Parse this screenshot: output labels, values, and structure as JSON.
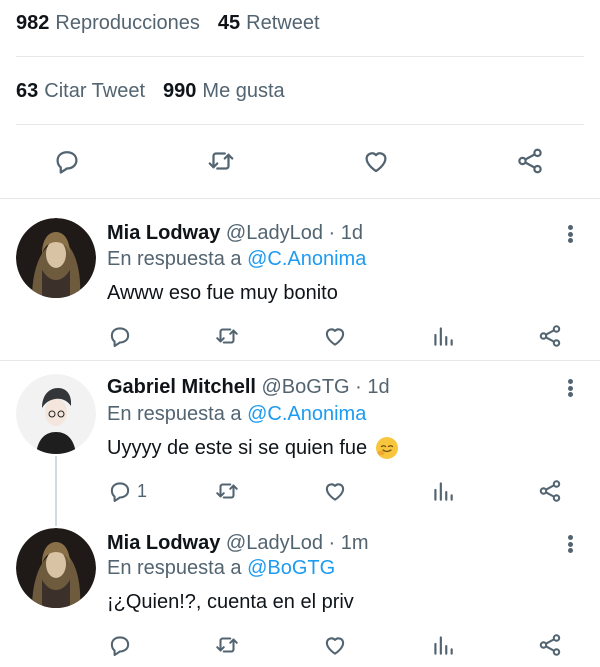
{
  "stats": {
    "views_count": "982",
    "views_label": "Reproducciones",
    "retweets_count": "45",
    "retweets_label": "Retweet",
    "quotes_count": "63",
    "quotes_label": "Citar Tweet",
    "likes_count": "990",
    "likes_label": "Me gusta"
  },
  "colors": {
    "accent": "#1d9bf0",
    "text": "#0f1419",
    "muted": "#536471",
    "divider": "#e4e8eb"
  },
  "main_actions": [
    "reply-icon",
    "retweet-icon",
    "like-icon",
    "share-icon"
  ],
  "replies": [
    {
      "name": "Mia Lodway",
      "handle": "@LadyLod",
      "time": "· 1d",
      "reply_prefix": "En respuesta a",
      "reply_to": "@C.Anonima",
      "text": "Awww eso fue muy bonito",
      "reply_count": ""
    },
    {
      "name": "Gabriel Mitchell",
      "handle": "@BoGTG",
      "time": "· 1d",
      "reply_prefix": "En respuesta a",
      "reply_to": "@C.Anonima",
      "text": "Uyyyy de este si se quien fue",
      "emoji": "smirking-face-emoji",
      "reply_count": "1"
    },
    {
      "name": "Mia Lodway",
      "handle": "@LadyLod",
      "time": "· 1m",
      "reply_prefix": "En respuesta a",
      "reply_to": "@BoGTG",
      "text": "¡¿Quien!?, cuenta en el priv",
      "reply_count": ""
    }
  ]
}
